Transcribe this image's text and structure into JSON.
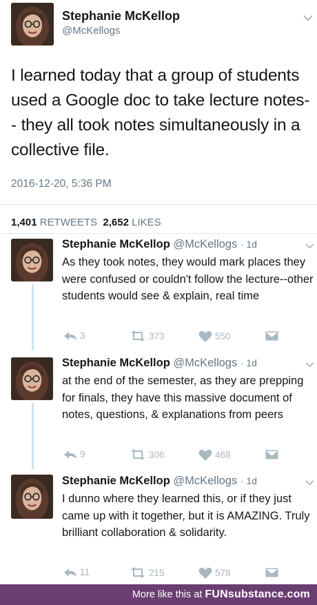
{
  "main_tweet": {
    "name": "Stephanie McKellop",
    "handle": "@McKellogs",
    "text": "I learned today that a group of students used a Google doc to take lecture notes-- they all took notes simultaneously in a collective file.",
    "timestamp": "2016-12-20, 5:36 PM",
    "retweets_count": "1,401",
    "retweets_label": "RETWEETS",
    "likes_count": "2,652",
    "likes_label": "LIKES"
  },
  "replies": [
    {
      "name": "Stephanie McKellop",
      "handle": "@McKellogs",
      "age": "· 1d",
      "text": "As they took notes, they would mark places they were confused or couldn't follow the lecture--other students would see & explain, real time",
      "reply_count": "3",
      "retweet_count": "373",
      "like_count": "550"
    },
    {
      "name": "Stephanie McKellop",
      "handle": "@McKellogs",
      "age": "· 1d",
      "text": "at the end of the semester, as they are prepping for finals, they have this massive document of notes, questions, & explanations from peers",
      "reply_count": "9",
      "retweet_count": "306",
      "like_count": "468"
    },
    {
      "name": "Stephanie McKellop",
      "handle": "@McKellogs",
      "age": "· 1d",
      "text": "I dunno where they learned this, or if they just came up with it together, but it is AMAZING. Truly brilliant collaboration & solidarity.",
      "reply_count": "11",
      "retweet_count": "215",
      "like_count": "578"
    }
  ],
  "footer": {
    "prefix": "More like this at ",
    "brand": "FUNsubstance.com"
  },
  "icons": [
    "chevron-down-icon",
    "reply-icon",
    "retweet-icon",
    "heart-icon",
    "message-icon"
  ],
  "colors": {
    "handle_gray": "#657786",
    "action_gray": "#aab8c2",
    "thread_line": "#cfe3f2",
    "footer_bg": "#6b3e72"
  }
}
